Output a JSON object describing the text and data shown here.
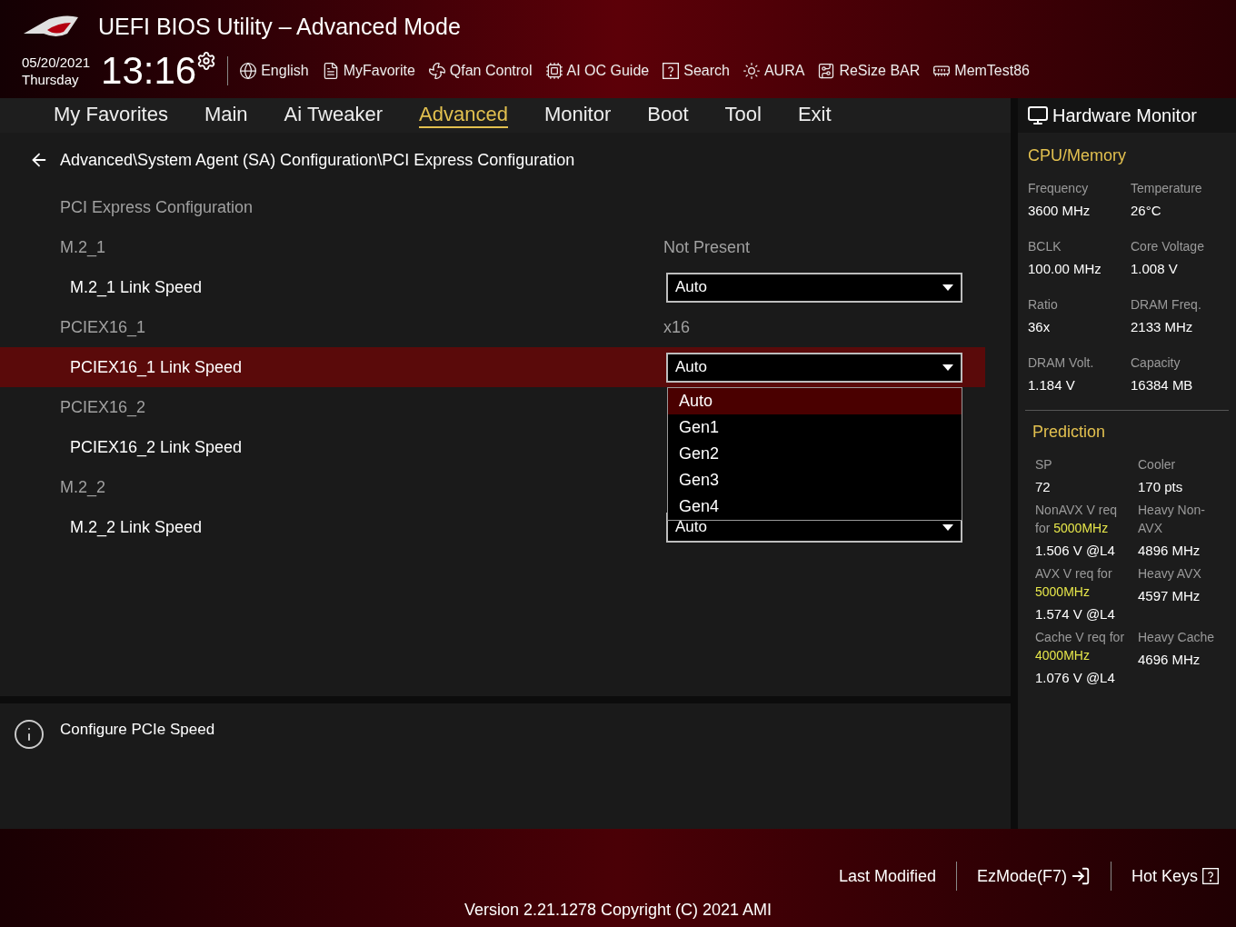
{
  "header": {
    "title": "UEFI BIOS Utility – Advanced Mode",
    "date": "05/20/2021",
    "day": "Thursday",
    "time": "13:16"
  },
  "toolbar": [
    "English",
    "MyFavorite",
    "Qfan Control",
    "AI OC Guide",
    "Search",
    "AURA",
    "ReSize BAR",
    "MemTest86"
  ],
  "tabs": [
    {
      "label": "My Favorites",
      "selected": false
    },
    {
      "label": "Main",
      "selected": false
    },
    {
      "label": "Ai Tweaker",
      "selected": false
    },
    {
      "label": "Advanced",
      "selected": true
    },
    {
      "label": "Monitor",
      "selected": false
    },
    {
      "label": "Boot",
      "selected": false
    },
    {
      "label": "Tool",
      "selected": false
    },
    {
      "label": "Exit",
      "selected": false
    }
  ],
  "breadcrumb": "Advanced\\System Agent (SA) Configuration\\PCI Express Configuration",
  "rows": [
    {
      "kind": "info",
      "label": "PCI Express Configuration"
    },
    {
      "kind": "info",
      "label": "M.2_1",
      "value": "Not Present"
    },
    {
      "kind": "setting",
      "label": "M.2_1 Link Speed",
      "value": "Auto",
      "selected": false
    },
    {
      "kind": "info",
      "label": "PCIEX16_1",
      "value": "x16"
    },
    {
      "kind": "setting",
      "label": "PCIEX16_1 Link Speed",
      "value": "Auto",
      "selected": true
    },
    {
      "kind": "info",
      "label": "PCIEX16_2"
    },
    {
      "kind": "setting",
      "label": "PCIEX16_2 Link Speed",
      "selected": false
    },
    {
      "kind": "info",
      "label": "M.2_2"
    },
    {
      "kind": "setting",
      "label": "M.2_2 Link Speed",
      "value": "Auto",
      "selected": false
    }
  ],
  "dropdown_menu": {
    "options": [
      {
        "label": "Auto",
        "selected": true
      },
      {
        "label": "Gen1",
        "selected": false
      },
      {
        "label": "Gen2",
        "selected": false
      },
      {
        "label": "Gen3",
        "selected": false
      },
      {
        "label": "Gen4",
        "selected": false
      }
    ]
  },
  "help": {
    "text": "Configure PCIe Speed"
  },
  "hardware_monitor": {
    "title": "Hardware Monitor",
    "sections": [
      {
        "title": "CPU/Memory",
        "items": [
          {
            "label": "Frequency",
            "value": "3600 MHz"
          },
          {
            "label": "Temperature",
            "value": "26°C"
          },
          {
            "label": "BCLK",
            "value": "100.00 MHz"
          },
          {
            "label": "Core Voltage",
            "value": "1.008 V"
          },
          {
            "label": "Ratio",
            "value": "36x"
          },
          {
            "label": "DRAM Freq.",
            "value": "2133 MHz"
          },
          {
            "label": "DRAM Volt.",
            "value": "1.184 V"
          },
          {
            "label": "Capacity",
            "value": "16384 MB"
          }
        ]
      },
      {
        "title": "Prediction",
        "items": [
          {
            "label": "SP",
            "value": "72"
          },
          {
            "label": "Cooler",
            "value": "170 pts"
          },
          {
            "label": "NonAVX V req for **5000MHz**",
            "value": "1.506 V @L4"
          },
          {
            "label": "Heavy Non-AVX",
            "value": "4896 MHz"
          },
          {
            "label": "AVX V req for **5000MHz**",
            "value": "1.574 V @L4"
          },
          {
            "label": "Heavy AVX",
            "value": "4597 MHz"
          },
          {
            "label": "Cache V req for **4000MHz**",
            "value": "1.076 V @L4"
          },
          {
            "label": "Heavy Cache",
            "value": "4696 MHz"
          }
        ]
      }
    ]
  },
  "footer": {
    "buttons": [
      "Last Modified",
      "EzMode(F7)",
      "Hot Keys"
    ],
    "version": "Version 2.21.1278 Copyright (C) 2021 AMI"
  }
}
